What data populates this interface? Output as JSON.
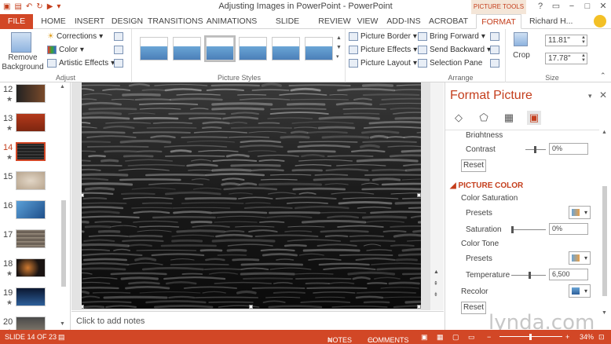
{
  "titlebar": {
    "title": "Adjusting Images in PowerPoint - PowerPoint",
    "contextual_tab_group": "PICTURE TOOLS",
    "window_buttons": [
      "?",
      "▭",
      "−",
      "□",
      "✕"
    ]
  },
  "tabs": [
    "FILE",
    "HOME",
    "INSERT",
    "DESIGN",
    "TRANSITIONS",
    "ANIMATIONS",
    "SLIDE SHOW",
    "REVIEW",
    "VIEW",
    "ADD-INS",
    "ACROBAT",
    "FORMAT"
  ],
  "user": "Richard H...",
  "ribbon": {
    "adjust": {
      "remove_bg_line1": "Remove",
      "remove_bg_line2": "Background",
      "corrections": "Corrections",
      "color": "Color",
      "artistic": "Artistic Effects",
      "label": "Adjust"
    },
    "styles": {
      "label": "Picture Styles"
    },
    "picture": {
      "border": "Picture Border",
      "effects": "Picture Effects",
      "layout": "Picture Layout"
    },
    "arrange": {
      "forward": "Bring Forward",
      "backward": "Send Backward",
      "pane": "Selection Pane",
      "label": "Arrange"
    },
    "size": {
      "crop": "Crop",
      "height": "11.81\"",
      "width": "17.78\"",
      "label": "Size"
    }
  },
  "slides": [
    {
      "num": "12",
      "star": "★"
    },
    {
      "num": "13",
      "star": "★"
    },
    {
      "num": "14",
      "star": "★"
    },
    {
      "num": "15",
      "star": ""
    },
    {
      "num": "16",
      "star": ""
    },
    {
      "num": "17",
      "star": ""
    },
    {
      "num": "18",
      "star": "★"
    },
    {
      "num": "19",
      "star": "★"
    },
    {
      "num": "20",
      "star": "★"
    }
  ],
  "notes_placeholder": "Click to add notes",
  "pane": {
    "title": "Format Picture",
    "brightness_partial": "Brightness",
    "contrast_label": "Contrast",
    "contrast_value": "0%",
    "reset1": "Reset",
    "section": "PICTURE COLOR",
    "saturation_heading": "Color Saturation",
    "presets1": "Presets",
    "saturation_label": "Saturation",
    "saturation_value": "0%",
    "tone_heading": "Color Tone",
    "presets2": "Presets",
    "temperature_label": "Temperature",
    "temperature_value": "6,500",
    "recolor_label": "Recolor",
    "reset2": "Reset"
  },
  "status": {
    "slide": "SLIDE 14 OF 23",
    "notes": "NOTES",
    "comments": "COMMENTS",
    "zoom": "34%"
  },
  "watermark": "lynda.com"
}
